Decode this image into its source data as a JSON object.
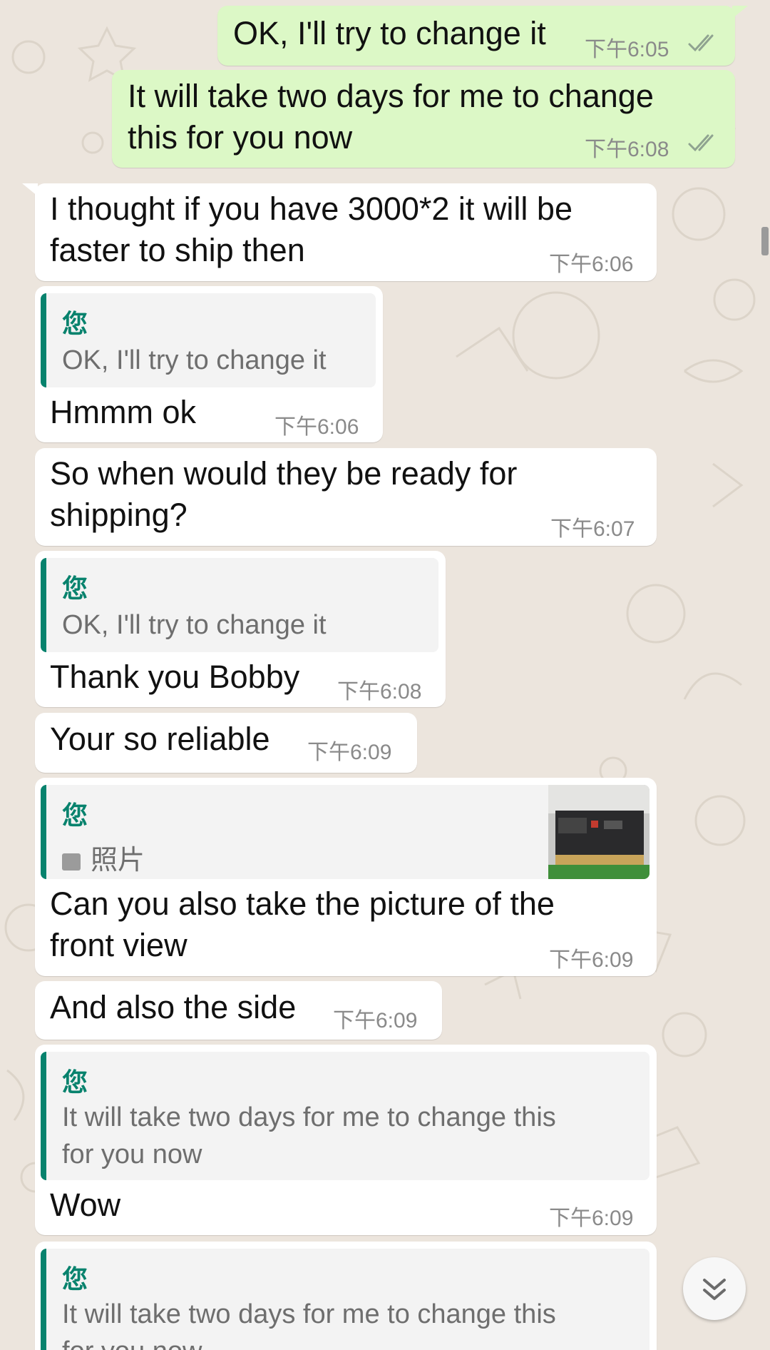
{
  "quote_sender": "您",
  "photo_label": "照片",
  "messages": [
    {
      "text_lines": [
        "OK, I'll try to change it"
      ],
      "time": "下午6:05"
    },
    {
      "text_lines": [
        "It will take two days for me to change",
        "this for you now"
      ],
      "time": "下午6:08"
    },
    {
      "text_lines": [
        "I thought if you have 3000*2 it will be",
        "faster to ship then"
      ],
      "time": "下午6:06"
    },
    {
      "quote_lines": [
        "OK, I'll try to change it"
      ],
      "text_lines": [
        "Hmmm ok"
      ],
      "time": "下午6:06"
    },
    {
      "text_lines": [
        "So when would they be ready for",
        "shipping?"
      ],
      "time": "下午6:07"
    },
    {
      "quote_lines": [
        "OK, I'll try to change it"
      ],
      "text_lines": [
        "Thank you Bobby"
      ],
      "time": "下午6:08"
    },
    {
      "text_lines": [
        "Your so reliable"
      ],
      "time": "下午6:09"
    },
    {
      "text_lines": [
        "Can you also take the picture of the",
        "front view"
      ],
      "time": "下午6:09"
    },
    {
      "text_lines": [
        "And also the side"
      ],
      "time": "下午6:09"
    },
    {
      "quote_lines": [
        "It will take two days for me to change this",
        "for you now"
      ],
      "text_lines": [
        "Wow"
      ],
      "time": "下午6:09"
    },
    {
      "quote_lines": [
        "It will take two days for me to change this",
        "for you now"
      ]
    }
  ],
  "colors": {
    "outgoing_bubble": "#dcf8c6",
    "incoming_bubble": "#ffffff",
    "quote_accent": "#07826d",
    "background": "#ece5dd"
  },
  "icons": {
    "read_receipt": "double-check-icon",
    "scroll_down": "double-chevron-down-icon",
    "photo": "image-icon"
  }
}
